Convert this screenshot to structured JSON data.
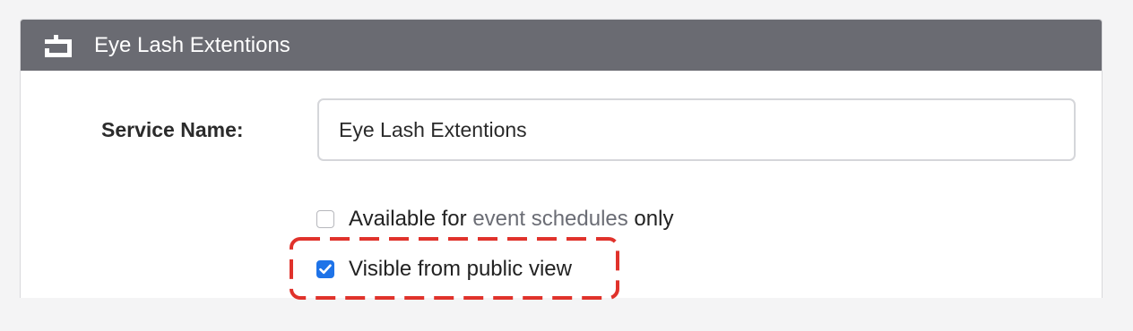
{
  "panel": {
    "title": "Eye Lash Extentions",
    "header_icon": "service-block-icon"
  },
  "form": {
    "service_name_label": "Service Name:",
    "service_name_value": "Eye Lash Extentions"
  },
  "options": {
    "event_only": {
      "checked": false,
      "prefix": "Available for ",
      "link": "event schedules",
      "suffix": " only"
    },
    "public_view": {
      "checked": true,
      "label": "Visible from public view"
    }
  },
  "colors": {
    "header_bg": "#6a6b72",
    "checkbox_checked": "#1e73e8",
    "annotation_red": "#e0322b",
    "link_gray": "#6b6d75"
  }
}
